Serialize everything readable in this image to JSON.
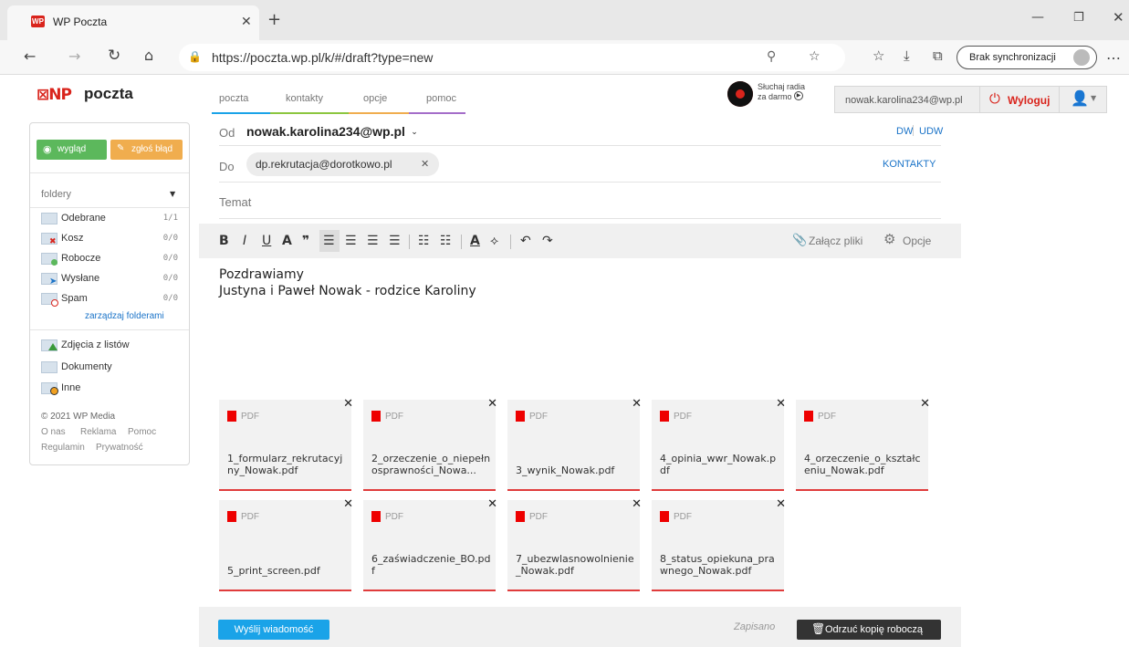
{
  "browser": {
    "tab_title": "WP Poczta",
    "url": "https://poczta.wp.pl/k/#/draft?type=new",
    "sync_label": "Brak synchronizacji"
  },
  "header": {
    "logo_text": "poczta",
    "nav": [
      "poczta",
      "kontakty",
      "opcje",
      "pomoc"
    ],
    "radio_line1": "Słuchaj radia",
    "radio_line2": "za darmo",
    "account_email": "nowak.karolina234@wp.pl",
    "logout_label": "Wyloguj"
  },
  "sidebar": {
    "view_button": "wygląd",
    "report_button": "zgłoś błąd",
    "folders_label": "foldery",
    "folders": [
      {
        "name": "Odebrane",
        "count": "1/1"
      },
      {
        "name": "Kosz",
        "count": "0/0"
      },
      {
        "name": "Robocze",
        "count": "0/0"
      },
      {
        "name": "Wysłane",
        "count": "0/0"
      },
      {
        "name": "Spam",
        "count": "0/0"
      }
    ],
    "manage_link": "zarządzaj folderami",
    "smart_folders": [
      "Zdjęcia z listów",
      "Dokumenty",
      "Inne"
    ],
    "copyright": "© 2021 WP Media",
    "footer_links_1": [
      "O nas",
      "Reklama",
      "Pomoc"
    ],
    "footer_links_2": [
      "Regulamin",
      "Prywatność"
    ]
  },
  "compose": {
    "from_label": "Od",
    "from_value": "nowak.karolina234@wp.pl",
    "dw_label": "DW",
    "udw_label": "UDW",
    "to_label": "Do",
    "to_value": "dp.rekrutacja@dorotkowo.pl",
    "contacts_label": "KONTAKTY",
    "subject_placeholder": "Temat",
    "attach_label": "Załącz pliki",
    "options_label": "Opcje",
    "body_line1": "Pozdrawiamy",
    "body_line2": "Justyna i Paweł Nowak - rodzice Karoliny",
    "pdf_label": "PDF",
    "attachments": [
      "1_formularz_rekrutacyjny_Nowak.pdf",
      "2_orzeczenie_o_niepełnosprawności_Nowa...",
      "3_wynik_Nowak.pdf",
      "4_opinia_wwr_Nowak.pdf",
      "4_orzeczenie_o_kształceniu_Nowak.pdf",
      "5_print_screen.pdf",
      "6_zaświadczenie_BO.pdf",
      "7_ubezwlasnowolnienie_Nowak.pdf",
      "8_status_opiekuna_prawnego_Nowak.pdf"
    ],
    "send_label": "Wyślij wiadomość",
    "saved_label": "Zapisano",
    "discard_label": "Odrzuć kopię roboczą"
  },
  "colors": {
    "accent": "#1aa3e8",
    "green": "#5cb85c",
    "orange": "#f0ad4e",
    "danger": "#d9241c"
  }
}
